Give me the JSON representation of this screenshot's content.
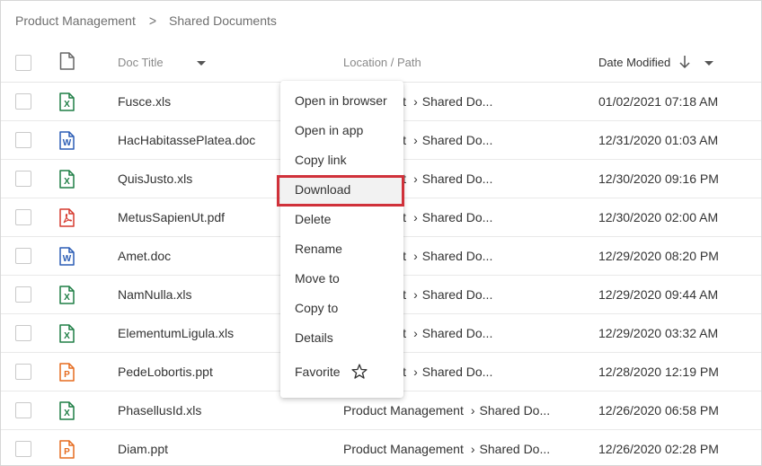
{
  "breadcrumb": {
    "parent": "Product Management",
    "separator": ">",
    "current": "Shared Documents"
  },
  "table": {
    "headers": {
      "doc_title": "Doc Title",
      "location": "Location / Path",
      "date_modified": "Date Modified"
    },
    "rows": [
      {
        "title": "Fusce.xls",
        "type": "xls",
        "location_folder": "anagement",
        "location_sub": "Shared Do...",
        "date": "01/02/2021 07:18 AM"
      },
      {
        "title": "HacHabitassePlatea.doc",
        "type": "doc",
        "location_folder": "anagement",
        "location_sub": "Shared Do...",
        "date": "12/31/2020 01:03 AM"
      },
      {
        "title": "QuisJusto.xls",
        "type": "xls",
        "location_folder": "anagement",
        "location_sub": "Shared Do...",
        "date": "12/30/2020 09:16 PM"
      },
      {
        "title": "MetusSapienUt.pdf",
        "type": "pdf",
        "location_folder": "anagement",
        "location_sub": "Shared Do...",
        "date": "12/30/2020 02:00 AM"
      },
      {
        "title": "Amet.doc",
        "type": "doc",
        "location_folder": "anagement",
        "location_sub": "Shared Do...",
        "date": "12/29/2020 08:20 PM"
      },
      {
        "title": "NamNulla.xls",
        "type": "xls",
        "location_folder": "anagement",
        "location_sub": "Shared Do...",
        "date": "12/29/2020 09:44 AM"
      },
      {
        "title": "ElementumLigula.xls",
        "type": "xls",
        "location_folder": "anagement",
        "location_sub": "Shared Do...",
        "date": "12/29/2020 03:32 AM"
      },
      {
        "title": "PedeLobortis.ppt",
        "type": "ppt",
        "location_folder": "anagement",
        "location_sub": "Shared Do...",
        "date": "12/28/2020 12:19 PM"
      },
      {
        "title": "PhasellusId.xls",
        "type": "xls",
        "location_folder": "Product Management",
        "location_sub": "Shared Do...",
        "date": "12/26/2020 06:58 PM"
      },
      {
        "title": "Diam.ppt",
        "type": "ppt",
        "location_folder": "Product Management",
        "location_sub": "Shared Do...",
        "date": "12/26/2020 02:28 PM"
      }
    ]
  },
  "context_menu": {
    "items": [
      {
        "label": "Open in browser"
      },
      {
        "label": "Open in app"
      },
      {
        "label": "Copy link"
      },
      {
        "label": "Download"
      },
      {
        "label": "Delete"
      },
      {
        "label": "Rename"
      },
      {
        "label": "Move to"
      },
      {
        "label": "Copy to"
      },
      {
        "label": "Details"
      },
      {
        "label": "Favorite",
        "icon": "star-outline-icon"
      }
    ],
    "highlighted": "Download"
  },
  "colors": {
    "highlight_border": "#d0313a",
    "xls": "#1e7e45",
    "doc": "#2b5db5",
    "pdf": "#d63a2f",
    "ppt": "#e56b1f"
  },
  "icons": {
    "document_header": "document-outline-icon",
    "sort": "arrow-down-icon",
    "dropdown": "caret-down-icon",
    "separator": "chevron-right-icon"
  }
}
